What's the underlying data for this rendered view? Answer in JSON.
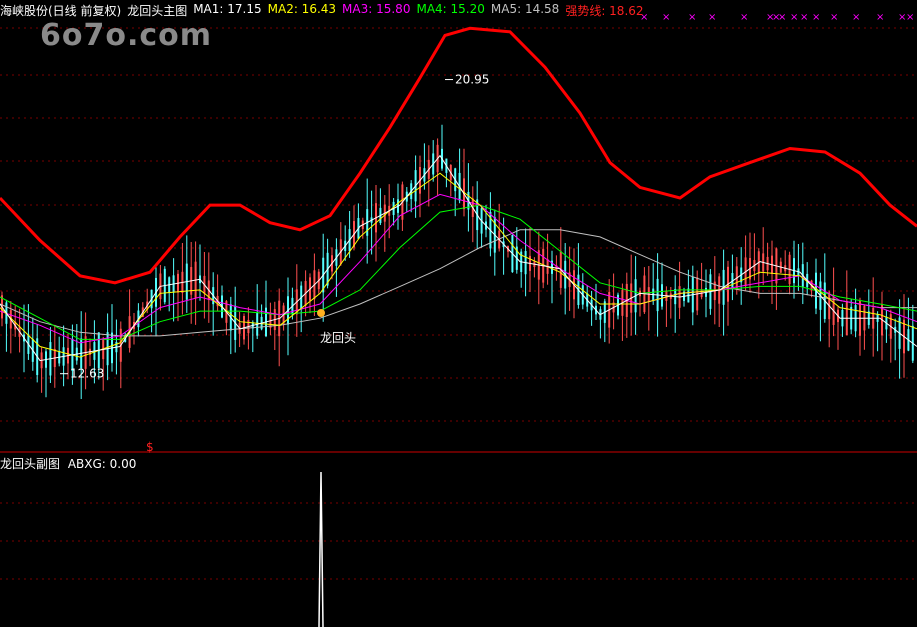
{
  "watermark": "6o7o.com",
  "header": {
    "title": "海峡股份(日线 前复权)",
    "indicator": "龙回头主图",
    "ma1": "MA1: 17.15",
    "ma2": "MA2: 16.43",
    "ma3": "MA3: 15.80",
    "ma4": "MA4: 15.20",
    "ma5": "MA5: 14.58",
    "strong": "强势线: 18.62"
  },
  "sub_header": {
    "title": "龙回头副图",
    "abxg": "ABXG: 0.00"
  },
  "colors": {
    "candle_up": "#ff5050",
    "candle_down": "#54ffff",
    "ma1": "#ffffff",
    "ma2": "#ffff00",
    "ma3": "#ff00ff",
    "ma4": "#00ff00",
    "ma5": "#c0c0c0",
    "strong": "#ff0000",
    "grid": "#7a0000",
    "signal_x": "#ff00ff"
  },
  "chart_data": {
    "type": "line",
    "title": "龙回头主图",
    "y_range": [
      10.5,
      23.2
    ],
    "annotations": {
      "high": "20.95",
      "low": "12.63",
      "signal": "龙回头",
      "dollar": "$"
    },
    "signal_marks": "×",
    "series": [
      {
        "name": "强势线",
        "points": [
          [
            0,
            17.6
          ],
          [
            40,
            16.4
          ],
          [
            80,
            15.4
          ],
          [
            115,
            15.2
          ],
          [
            150,
            15.5
          ],
          [
            180,
            16.5
          ],
          [
            210,
            17.4
          ],
          [
            240,
            17.4
          ],
          [
            270,
            16.9
          ],
          [
            300,
            16.7
          ],
          [
            330,
            17.1
          ],
          [
            360,
            18.3
          ],
          [
            390,
            19.6
          ],
          [
            420,
            21.0
          ],
          [
            445,
            22.2
          ],
          [
            470,
            22.4
          ],
          [
            510,
            22.3
          ],
          [
            545,
            21.3
          ],
          [
            580,
            20.0
          ],
          [
            610,
            18.6
          ],
          [
            640,
            17.9
          ],
          [
            680,
            17.6
          ],
          [
            710,
            18.2
          ],
          [
            750,
            18.6
          ],
          [
            790,
            19.0
          ],
          [
            825,
            18.9
          ],
          [
            860,
            18.3
          ],
          [
            890,
            17.4
          ],
          [
            917,
            16.8
          ]
        ]
      },
      {
        "name": "MA5",
        "points": [
          [
            0,
            14.6
          ],
          [
            40,
            14.1
          ],
          [
            80,
            13.8
          ],
          [
            120,
            13.7
          ],
          [
            160,
            13.7
          ],
          [
            200,
            13.8
          ],
          [
            240,
            13.9
          ],
          [
            280,
            14.0
          ],
          [
            320,
            14.2
          ],
          [
            360,
            14.6
          ],
          [
            400,
            15.1
          ],
          [
            440,
            15.6
          ],
          [
            480,
            16.2
          ],
          [
            520,
            16.7
          ],
          [
            560,
            16.7
          ],
          [
            600,
            16.5
          ],
          [
            640,
            16.0
          ],
          [
            680,
            15.5
          ],
          [
            720,
            15.1
          ],
          [
            760,
            14.9
          ],
          [
            800,
            14.9
          ],
          [
            840,
            14.7
          ],
          [
            880,
            14.5
          ],
          [
            917,
            14.5
          ]
        ]
      },
      {
        "name": "MA4",
        "points": [
          [
            0,
            14.8
          ],
          [
            40,
            14.2
          ],
          [
            80,
            13.6
          ],
          [
            120,
            13.6
          ],
          [
            160,
            14.1
          ],
          [
            200,
            14.4
          ],
          [
            240,
            14.4
          ],
          [
            280,
            14.3
          ],
          [
            320,
            14.4
          ],
          [
            360,
            15.0
          ],
          [
            400,
            16.2
          ],
          [
            440,
            17.2
          ],
          [
            480,
            17.4
          ],
          [
            520,
            17.0
          ],
          [
            560,
            16.1
          ],
          [
            600,
            15.2
          ],
          [
            640,
            14.9
          ],
          [
            680,
            15.0
          ],
          [
            720,
            15.0
          ],
          [
            760,
            15.1
          ],
          [
            800,
            15.1
          ],
          [
            840,
            14.8
          ],
          [
            880,
            14.6
          ],
          [
            917,
            14.4
          ]
        ]
      },
      {
        "name": "MA3",
        "points": [
          [
            0,
            14.4
          ],
          [
            40,
            14.0
          ],
          [
            80,
            13.5
          ],
          [
            120,
            13.7
          ],
          [
            160,
            14.5
          ],
          [
            200,
            14.8
          ],
          [
            240,
            14.5
          ],
          [
            280,
            14.3
          ],
          [
            320,
            14.6
          ],
          [
            360,
            15.8
          ],
          [
            400,
            17.1
          ],
          [
            440,
            17.7
          ],
          [
            480,
            17.4
          ],
          [
            520,
            16.4
          ],
          [
            560,
            15.6
          ],
          [
            600,
            14.9
          ],
          [
            640,
            14.6
          ],
          [
            680,
            14.9
          ],
          [
            720,
            15.0
          ],
          [
            760,
            15.2
          ],
          [
            800,
            15.4
          ],
          [
            840,
            14.7
          ],
          [
            880,
            14.5
          ],
          [
            917,
            14.1
          ]
        ]
      },
      {
        "name": "MA2",
        "points": [
          [
            0,
            14.5
          ],
          [
            40,
            13.4
          ],
          [
            80,
            13.1
          ],
          [
            120,
            13.5
          ],
          [
            160,
            14.9
          ],
          [
            200,
            15.0
          ],
          [
            240,
            14.1
          ],
          [
            280,
            14.0
          ],
          [
            320,
            14.9
          ],
          [
            360,
            16.5
          ],
          [
            400,
            17.5
          ],
          [
            440,
            18.3
          ],
          [
            480,
            17.4
          ],
          [
            520,
            16.0
          ],
          [
            560,
            15.5
          ],
          [
            600,
            14.6
          ],
          [
            640,
            14.6
          ],
          [
            680,
            14.9
          ],
          [
            720,
            15.0
          ],
          [
            760,
            15.5
          ],
          [
            800,
            15.4
          ],
          [
            840,
            14.5
          ],
          [
            880,
            14.3
          ],
          [
            917,
            13.9
          ]
        ]
      },
      {
        "name": "MA1",
        "points": [
          [
            0,
            14.6
          ],
          [
            40,
            13.0
          ],
          [
            80,
            13.2
          ],
          [
            120,
            13.4
          ],
          [
            160,
            15.1
          ],
          [
            200,
            15.3
          ],
          [
            240,
            13.9
          ],
          [
            280,
            14.2
          ],
          [
            320,
            15.3
          ],
          [
            360,
            16.8
          ],
          [
            400,
            17.4
          ],
          [
            440,
            18.8
          ],
          [
            480,
            17.0
          ],
          [
            520,
            15.8
          ],
          [
            560,
            15.6
          ],
          [
            600,
            14.3
          ],
          [
            640,
            14.9
          ],
          [
            680,
            14.8
          ],
          [
            720,
            15.0
          ],
          [
            760,
            15.8
          ],
          [
            800,
            15.5
          ],
          [
            840,
            14.2
          ],
          [
            880,
            14.2
          ],
          [
            917,
            13.4
          ]
        ]
      }
    ],
    "sub_chart": {
      "name": "ABXG",
      "y_range": [
        0,
        1
      ],
      "spikes": [
        [
          321,
          1
        ]
      ]
    }
  }
}
